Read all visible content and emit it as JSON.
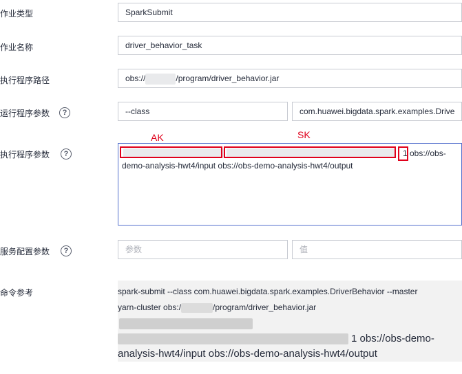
{
  "form": {
    "job_type": {
      "label": "作业类型",
      "value": "SparkSubmit"
    },
    "job_name": {
      "label": "作业名称",
      "value": "driver_behavior_task"
    },
    "exec_path": {
      "label": "执行程序路径",
      "value_prefix": "obs://",
      "value_suffix": "/program/driver_behavior.jar"
    },
    "run_params": {
      "label": "运行程序参数",
      "key": "--class",
      "value": "com.huawei.bigdata.spark.examples.Drive"
    },
    "exec_params": {
      "label": "执行程序参数",
      "line1_tail": "1 obs://obs-",
      "line2": "demo-analysis-hwt4/input  obs://obs-demo-analysis-hwt4/output",
      "annot_ak": "AK",
      "annot_sk": "SK"
    },
    "service_config": {
      "label": "服务配置参数",
      "key_placeholder": "参数",
      "value_placeholder": "值"
    },
    "command": {
      "label": "命令参考",
      "line1": "spark-submit  --class com.huawei.bigdata.spark.examples.DriverBehavior  --master",
      "line2_prefix": "yarn-cluster  obs:/",
      "line2_suffix": "/program/driver_behavior.jar",
      "line4_tail": "1 obs://obs-demo-",
      "line5": "analysis-hwt4/input  obs://obs-demo-analysis-hwt4/output"
    }
  }
}
